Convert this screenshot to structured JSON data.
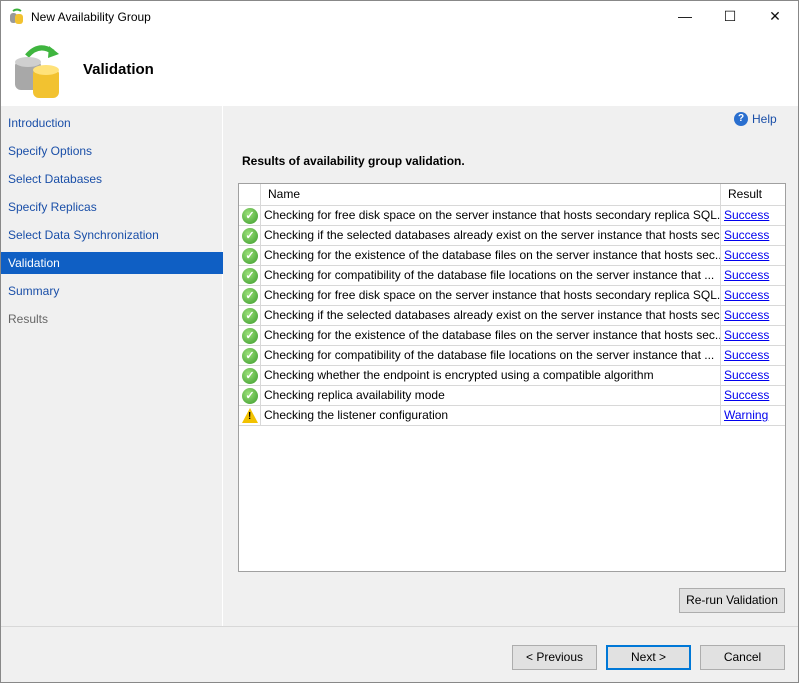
{
  "window": {
    "title": "New Availability Group",
    "minimize": "—",
    "maximize": "☐",
    "close": "✕"
  },
  "header": {
    "title": "Validation"
  },
  "sidebar": {
    "items": [
      {
        "label": "Introduction",
        "state": "link"
      },
      {
        "label": "Specify Options",
        "state": "link"
      },
      {
        "label": "Select Databases",
        "state": "link"
      },
      {
        "label": "Specify Replicas",
        "state": "link"
      },
      {
        "label": "Select Data Synchronization",
        "state": "link"
      },
      {
        "label": "Validation",
        "state": "selected"
      },
      {
        "label": "Summary",
        "state": "link"
      },
      {
        "label": "Results",
        "state": "disabled"
      }
    ]
  },
  "main": {
    "help": "Help",
    "results_title": "Results of availability group validation.",
    "columns": {
      "name": "Name",
      "result": "Result"
    },
    "rows": [
      {
        "name": "Checking for free disk space on the server instance that hosts secondary replica SQL...",
        "result": "Success",
        "icon": "success"
      },
      {
        "name": "Checking if the selected databases already exist on the server instance that hosts sec...",
        "result": "Success",
        "icon": "success"
      },
      {
        "name": "Checking for the existence of the database files on the server instance that hosts sec...",
        "result": "Success",
        "icon": "success"
      },
      {
        "name": "Checking for compatibility of the database file locations on the server instance that ...",
        "result": "Success",
        "icon": "success"
      },
      {
        "name": "Checking for free disk space on the server instance that hosts secondary replica SQL...",
        "result": "Success",
        "icon": "success"
      },
      {
        "name": "Checking if the selected databases already exist on the server instance that hosts sec...",
        "result": "Success",
        "icon": "success"
      },
      {
        "name": "Checking for the existence of the database files on the server instance that hosts sec...",
        "result": "Success",
        "icon": "success"
      },
      {
        "name": "Checking for compatibility of the database file locations on the server instance that ...",
        "result": "Success",
        "icon": "success"
      },
      {
        "name": "Checking whether the endpoint is encrypted using a compatible algorithm",
        "result": "Success",
        "icon": "success"
      },
      {
        "name": "Checking replica availability mode",
        "result": "Success",
        "icon": "success"
      },
      {
        "name": "Checking the listener configuration",
        "result": "Warning",
        "icon": "warning"
      }
    ],
    "rerun": "Re-run Validation"
  },
  "footer": {
    "previous": "< Previous",
    "next": "Next >",
    "cancel": "Cancel"
  }
}
